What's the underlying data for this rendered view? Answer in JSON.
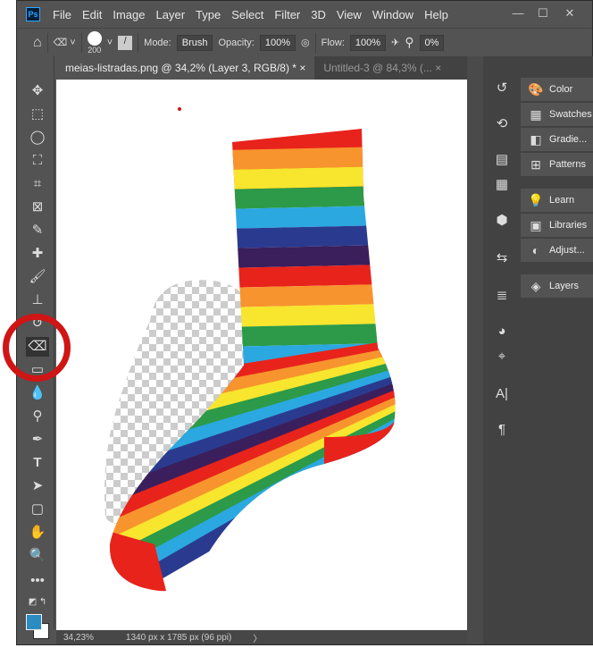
{
  "app": {
    "logo": "Ps",
    "menu": [
      "File",
      "Edit",
      "Image",
      "Layer",
      "Type",
      "Select",
      "Filter",
      "3D",
      "View",
      "Window",
      "Help"
    ]
  },
  "window_controls": {
    "minimize": "—",
    "maximize": "☐",
    "close": "✕"
  },
  "options": {
    "brush_size": "200",
    "mode_label": "Mode:",
    "mode_value": "Brush",
    "opacity_label": "Opacity:",
    "opacity_value": "100%",
    "flow_label": "Flow:",
    "flow_value": "100%",
    "smoothing_value": "0%"
  },
  "tabs": [
    {
      "label": "meias-listradas.png @ 34,2% (Layer 3, RGB/8) *",
      "close": "×"
    },
    {
      "label": "Untitled-3 @ 84,3% (...",
      "close": "×"
    }
  ],
  "status": {
    "zoom": "34,23%",
    "doc_info": "1340 px x 1785 px (96 ppi)",
    "arrow": "〉"
  },
  "colors": {
    "foreground": "#2a8cc0",
    "background": "#ffffff",
    "annotation": "#d01515"
  },
  "panels": [
    {
      "icon": "palette-icon",
      "label": "Color"
    },
    {
      "icon": "grid-icon",
      "label": "Swatches"
    },
    {
      "icon": "gradient-icon",
      "label": "Gradie..."
    },
    {
      "icon": "patterns-icon",
      "label": "Patterns"
    },
    {
      "icon": "lightbulb-icon",
      "label": "Learn"
    },
    {
      "icon": "libraries-icon",
      "label": "Libraries"
    },
    {
      "icon": "adjust-icon",
      "label": "Adjust..."
    },
    {
      "icon": "layers-icon",
      "label": "Layers"
    }
  ],
  "sock_stripes": [
    "#e8231c",
    "#f7942d",
    "#f8e52d",
    "#2c9a48",
    "#2ba8e0",
    "#2a3b8f",
    "#3a1f5c",
    "#e8231c",
    "#f7942d",
    "#f8e52d",
    "#2c9a48",
    "#2ba8e0",
    "#2a3b8f"
  ]
}
